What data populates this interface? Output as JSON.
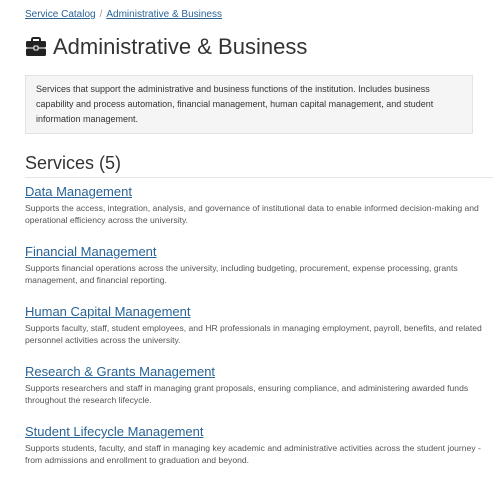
{
  "breadcrumb": {
    "items": [
      "Service Catalog",
      "Administrative & Business"
    ],
    "separator": "/"
  },
  "header": {
    "icon": "briefcase-icon",
    "title": "Administrative & Business"
  },
  "description": "Services that support the administrative and business functions of the institution. Includes business capability and process automation, financial management, human capital management, and student information management.",
  "services": {
    "heading": "Services (5)",
    "items": [
      {
        "title": "Data Management",
        "description": "Supports the access, integration, analysis, and governance of institutional data to enable informed decision-making and operational efficiency across the university."
      },
      {
        "title": "Financial Management",
        "description": "Supports financial operations across the university, including budgeting, procurement, expense processing, grants management, and financial reporting."
      },
      {
        "title": "Human Capital Management",
        "description": "Supports faculty, staff, student employees, and HR professionals in managing employment, payroll, benefits, and related personnel activities across the university."
      },
      {
        "title": "Research & Grants Management",
        "description": "Supports researchers and staff in managing grant proposals, ensuring compliance, and administering awarded funds throughout the research lifecycle."
      },
      {
        "title": "Student Lifecycle Management",
        "description": "Supports students, faculty, and staff in managing key academic and administrative activities across the student journey - from admissions and enrollment to graduation and beyond."
      }
    ]
  },
  "colors": {
    "link": "#2a6496",
    "text": "#333333",
    "well_background": "#f5f5f5"
  }
}
